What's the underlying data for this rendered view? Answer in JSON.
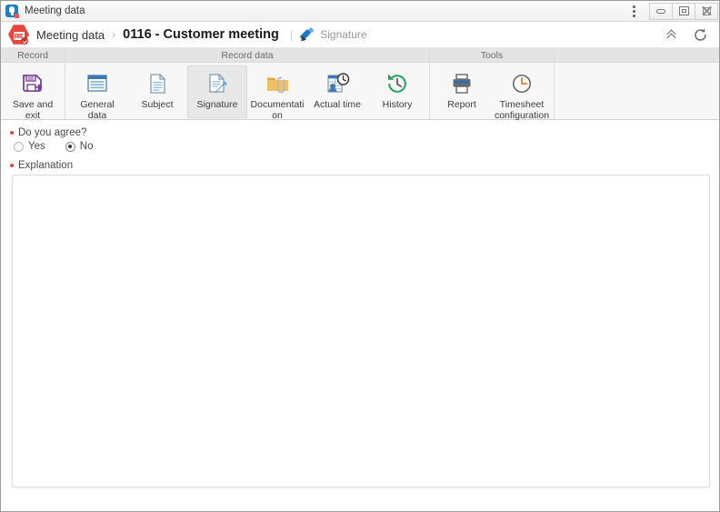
{
  "window": {
    "title": "Meeting data",
    "app_icon": "app-icon",
    "kebab_icon": "kebab-menu-icon",
    "controls": [
      {
        "name": "minimize",
        "label": "Minimize"
      },
      {
        "name": "maximize",
        "label": "Maximize"
      },
      {
        "name": "close",
        "label": "Close"
      }
    ]
  },
  "breadcrumb": {
    "record_icon": "calendar-record-icon",
    "root": "Meeting data",
    "separator": "›",
    "current": "0116 - Customer meeting",
    "pipe": "|",
    "section_icon": "pen-icon",
    "section": "Signature",
    "actions": [
      {
        "name": "collapse-ribbon",
        "icon": "chevron-double-up-icon",
        "label": "Collapse ribbon"
      },
      {
        "name": "refresh",
        "icon": "refresh-icon",
        "label": "Refresh"
      }
    ]
  },
  "ribbon": {
    "groups": [
      {
        "title": "Record",
        "buttons": [
          {
            "label": "Save and exit",
            "icon": "save-and-exit-icon",
            "selected": false,
            "has_menu": false
          }
        ]
      },
      {
        "title": "Record data",
        "buttons": [
          {
            "label": "General data",
            "icon": "general-data-icon",
            "selected": false,
            "has_menu": false
          },
          {
            "label": "Subject",
            "icon": "subject-icon",
            "selected": false,
            "has_menu": false
          },
          {
            "label": "Signature",
            "icon": "signature-icon",
            "selected": true,
            "has_menu": false
          },
          {
            "label": "Documentation",
            "icon": "documentation-icon",
            "selected": false,
            "has_menu": true
          },
          {
            "label": "Actual time",
            "icon": "actual-time-icon",
            "selected": false,
            "has_menu": false
          },
          {
            "label": "History",
            "icon": "history-icon",
            "selected": false,
            "has_menu": false
          }
        ]
      },
      {
        "title": "Tools",
        "buttons": [
          {
            "label": "Report",
            "icon": "report-icon",
            "selected": false,
            "has_menu": false
          },
          {
            "label": "Timesheet configuration",
            "icon": "timesheet-configuration-icon",
            "selected": false,
            "has_menu": false
          }
        ]
      }
    ]
  },
  "form": {
    "agree_field": {
      "label": "Do you agree?",
      "required": true,
      "options": [
        {
          "label": "Yes",
          "value": "yes",
          "checked": false
        },
        {
          "label": "No",
          "value": "no",
          "checked": true
        }
      ]
    },
    "explanation_field": {
      "label": "Explanation",
      "required": true,
      "value": "",
      "placeholder": ""
    }
  },
  "colors": {
    "required_marker": "#e8453c",
    "record_badge": "#e8453c",
    "accent_blue": "#1878c8",
    "save_purple": "#7b3f98",
    "history_green": "#21a05a",
    "timesheet_orange": "#e8762c",
    "folder_amber": "#e5a83c"
  }
}
